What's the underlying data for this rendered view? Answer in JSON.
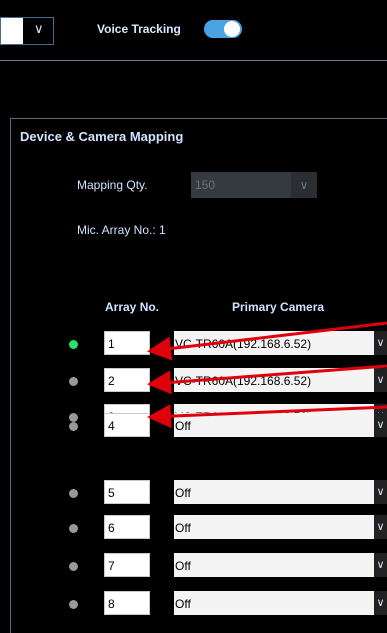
{
  "topbar": {
    "select_chevron": "∨",
    "voice_tracking_label": "Voice Tracking",
    "voice_tracking_on": true
  },
  "section": {
    "title": "Device & Camera Mapping",
    "mapping_qty_label": "Mapping Qty.",
    "mapping_qty_value": "150",
    "mapping_qty_chevron": "∨",
    "mic_array_label": "Mic. Array No.: 1"
  },
  "table": {
    "headers": {
      "array_no": "Array No.",
      "primary_camera": "Primary Camera"
    },
    "rows": [
      {
        "active": true,
        "array_no": "1",
        "camera": "VC-TR60A(192.168.6.52)"
      },
      {
        "active": false,
        "array_no": "2",
        "camera": "VC-TR60A(192.168.6.52)"
      },
      {
        "active": false,
        "array_no": "3",
        "camera": "VC-TR60A(192.168.6.52)"
      },
      {
        "active": false,
        "array_no": "4",
        "camera": "Off"
      },
      {
        "active": false,
        "array_no": "5",
        "camera": "Off"
      },
      {
        "active": false,
        "array_no": "6",
        "camera": "Off"
      },
      {
        "active": false,
        "array_no": "7",
        "camera": "Off"
      },
      {
        "active": false,
        "array_no": "8",
        "camera": "Off"
      }
    ],
    "row_chevron": "∨"
  },
  "colors": {
    "active_dot": "#28e06a",
    "inactive_dot": "#9a9a9a",
    "toggle_on": "#4aa3e3",
    "annotation_arrow": "#e0000b"
  }
}
